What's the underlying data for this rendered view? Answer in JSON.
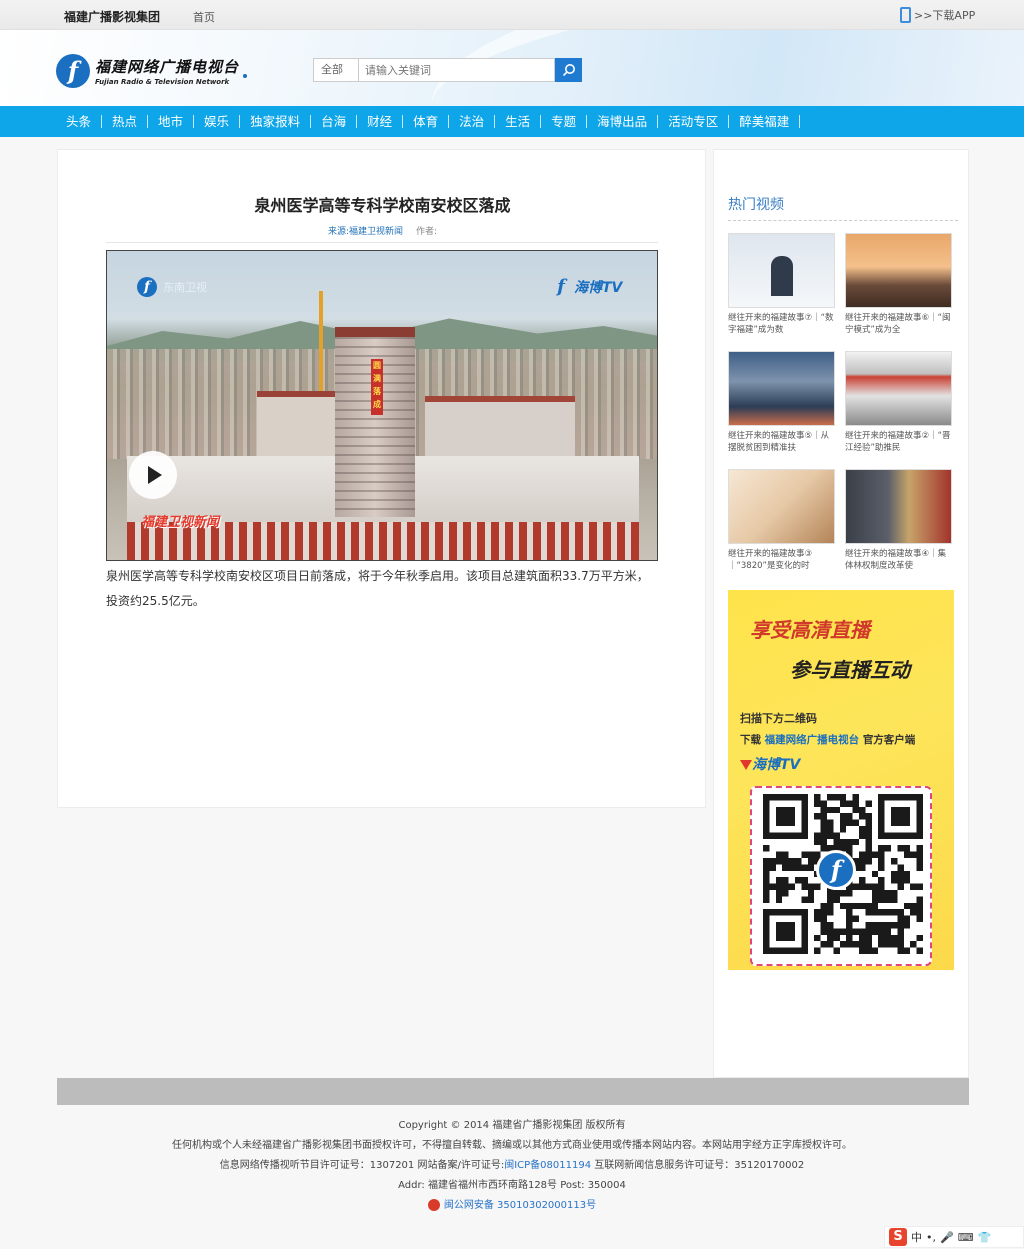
{
  "topbar": {
    "group_name": "福建广播影视集团",
    "home_link": "首页",
    "download_app": ">>下载APP"
  },
  "header": {
    "logo_cn": "福建网络广播电视台",
    "logo_en": "Fujian Radio & Television Network",
    "search_scope": "全部",
    "search_placeholder": "请输入关键词"
  },
  "nav": {
    "items": [
      "头条",
      "热点",
      "地市",
      "娱乐",
      "独家报料",
      "台海",
      "财经",
      "体育",
      "法治",
      "生活",
      "专题",
      "海博出品",
      "活动专区",
      "醉美福建"
    ]
  },
  "article": {
    "title": "泉州医学高等专科学校南安校区落成",
    "source": "来源:福建卫视新闻",
    "author": "作者:",
    "video": {
      "logo_left": "东南卫视",
      "logo_right": "海博TV",
      "caption": "福建卫视新闻",
      "banner": "圆满落成"
    },
    "body": "泉州医学高等专科学校南安校区项目日前落成，将于今年秋季启用。该项目总建筑面积33.7万平方米，投资约25.5亿元。"
  },
  "sidebar": {
    "title": "热门视频",
    "videos": [
      {
        "caption": "继往开来的福建故事⑦｜“数字福建”成为数"
      },
      {
        "caption": "继往开来的福建故事⑥｜“闽宁模式”成为全"
      },
      {
        "caption": "继往开来的福建故事⑤｜从摆脱贫困到精准扶"
      },
      {
        "caption": "继往开来的福建故事②｜“晋江经验”助推民"
      },
      {
        "caption": "继往开来的福建故事③｜“3820”是变化的时"
      },
      {
        "caption": "继往开来的福建故事④｜集体林权制度改革使"
      }
    ],
    "promo": {
      "line1": "享受高清直播",
      "line2": "参与直播互动",
      "line3": "扫描下方二维码",
      "line4_prefix": "下载",
      "line4_brand": "福建网络广播电视台",
      "line4_suffix": "官方客户端",
      "line5": "海博TV"
    }
  },
  "footer": {
    "copyright": "Copyright © 2014 福建省广播影视集团 版权所有",
    "notice": "任何机构或个人未经福建省广播影视集团书面授权许可，不得擅自转载、摘编或以其他方式商业使用或传播本网站内容。本网站用字经方正字库授权许可。",
    "license_prefix": "信息网络传播视听节目许可证号：1307201 网站备案/许可证号:",
    "icp": "闽ICP备08011194",
    "license_suffix": " 互联网新闻信息服务许可证号：35120170002",
    "address": "Addr:  福建省福州市西环南路128号 Post:  350004",
    "police": "闽公网安备 35010302000113号"
  },
  "ime": {
    "label": "中"
  }
}
